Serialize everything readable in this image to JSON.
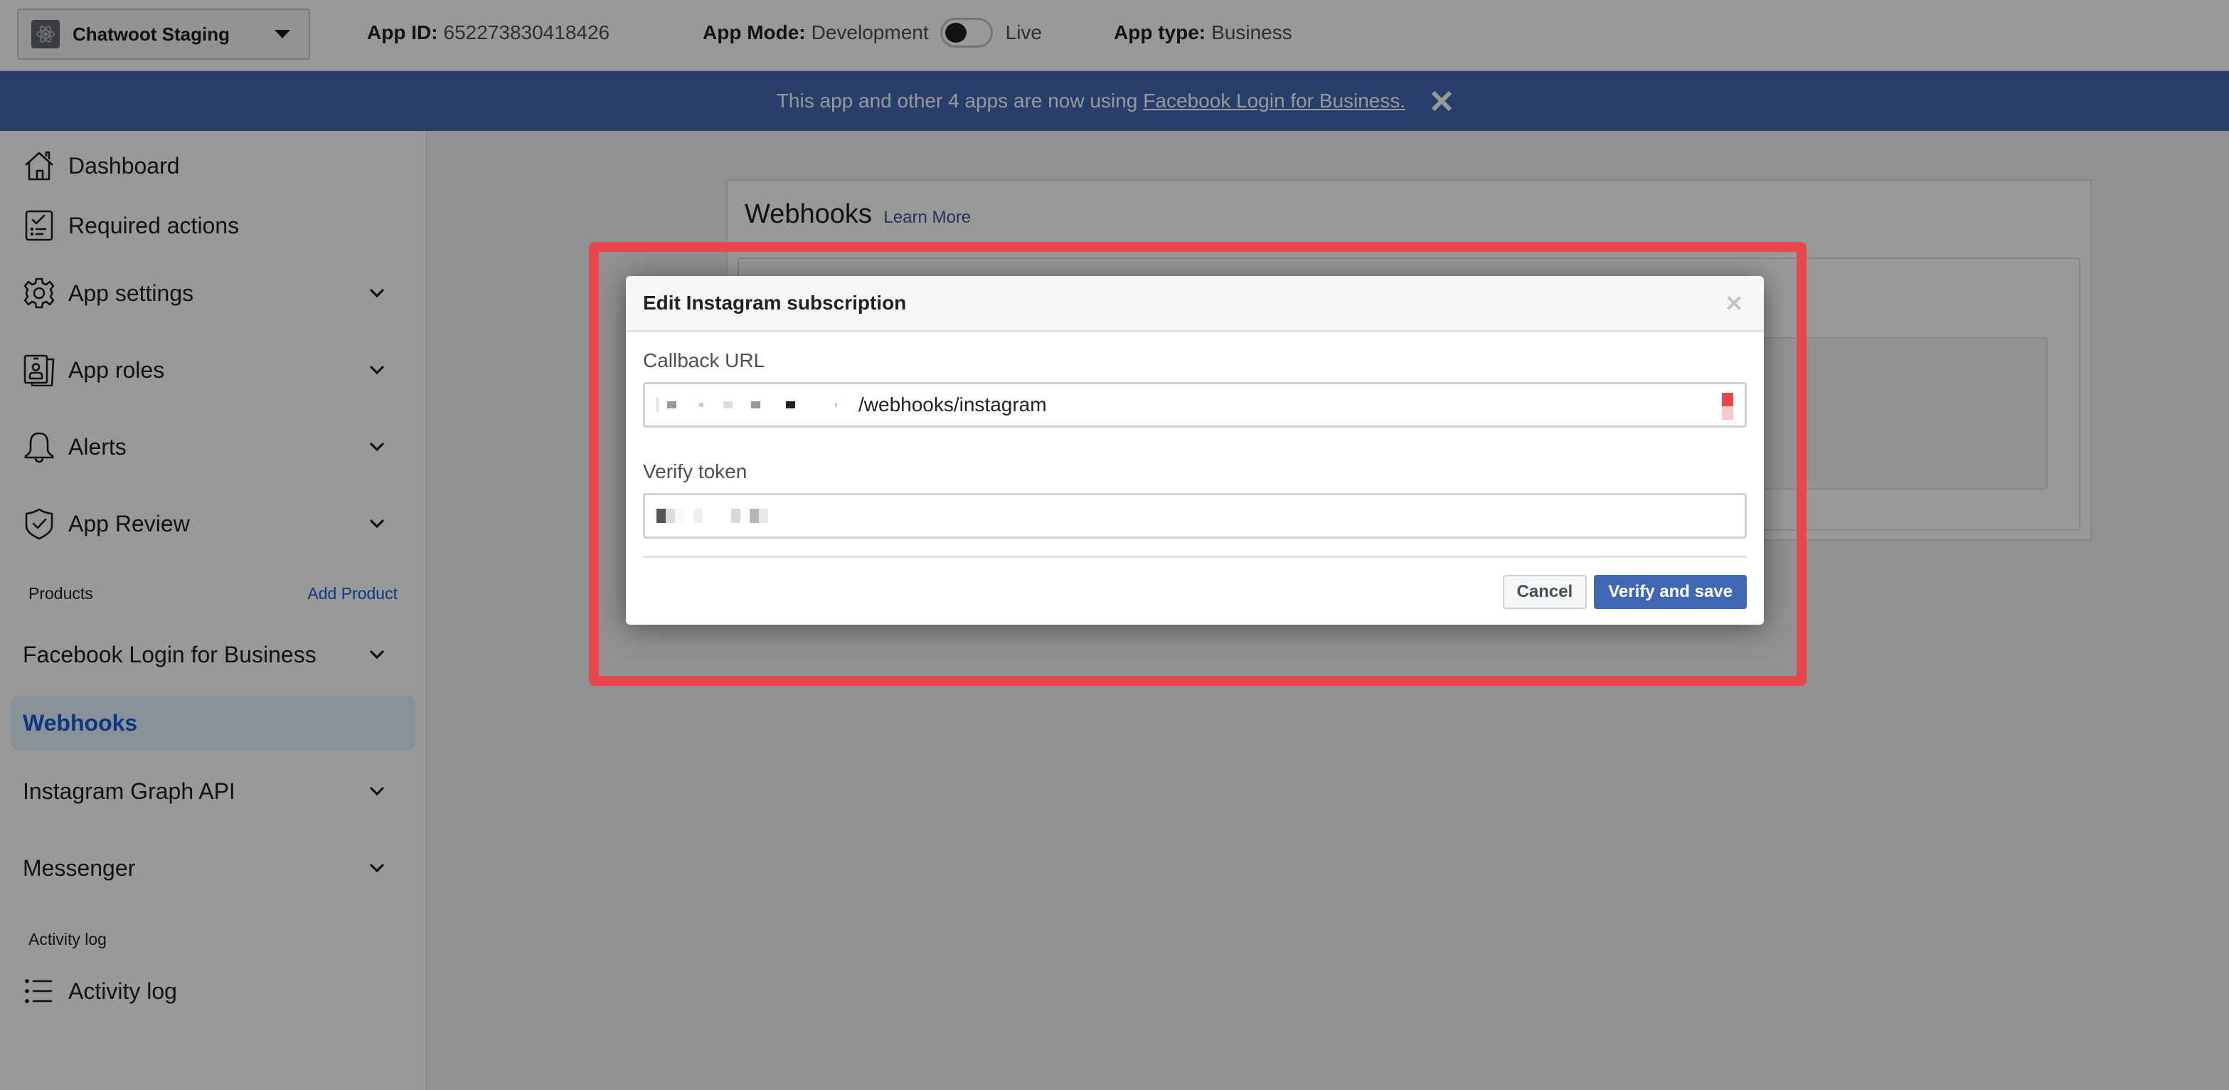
{
  "topbar": {
    "app_name": "Chatwoot Staging",
    "app_id_label": "App ID:",
    "app_id_value": "652273830418426",
    "app_mode_label": "App Mode:",
    "app_mode_value": "Development",
    "app_mode_live_label": "Live",
    "app_mode_live_enabled": false,
    "app_type_label": "App type:",
    "app_type_value": "Business"
  },
  "banner": {
    "text": "This app and other 4 apps are now using",
    "link_text": "Facebook Login for Business."
  },
  "sidebar": {
    "items": [
      {
        "label": "Dashboard",
        "icon": "home-icon",
        "expandable": false
      },
      {
        "label": "Required actions",
        "icon": "checklist-icon",
        "expandable": false
      },
      {
        "label": "App settings",
        "icon": "gear-icon",
        "expandable": true
      },
      {
        "label": "App roles",
        "icon": "id-badge-icon",
        "expandable": true
      },
      {
        "label": "Alerts",
        "icon": "bell-icon",
        "expandable": true
      },
      {
        "label": "App Review",
        "icon": "shield-check-icon",
        "expandable": true
      }
    ],
    "products_section_label": "Products",
    "add_product_label": "Add Product",
    "products": [
      {
        "label": "Facebook Login for Business",
        "expandable": true,
        "active": false
      },
      {
        "label": "Webhooks",
        "expandable": false,
        "active": true
      },
      {
        "label": "Instagram Graph API",
        "expandable": true,
        "active": false
      },
      {
        "label": "Messenger",
        "expandable": true,
        "active": false
      }
    ],
    "activity_section_label": "Activity log",
    "activity_item": {
      "label": "Activity log",
      "icon": "list-icon"
    }
  },
  "main": {
    "card_title": "Webhooks",
    "learn_more_label": "Learn More"
  },
  "modal": {
    "title": "Edit Instagram subscription",
    "callback_url_label": "Callback URL",
    "callback_url_value_visible": "/webhooks/instagram",
    "callback_url_prefix_redacted": true,
    "verify_token_label": "Verify token",
    "verify_token_redacted": true,
    "cancel_label": "Cancel",
    "submit_label": "Verify and save"
  },
  "colors": {
    "brand_blue": "#4267b2",
    "active_link": "#1a5ad7",
    "highlight_red": "#e8484b"
  }
}
